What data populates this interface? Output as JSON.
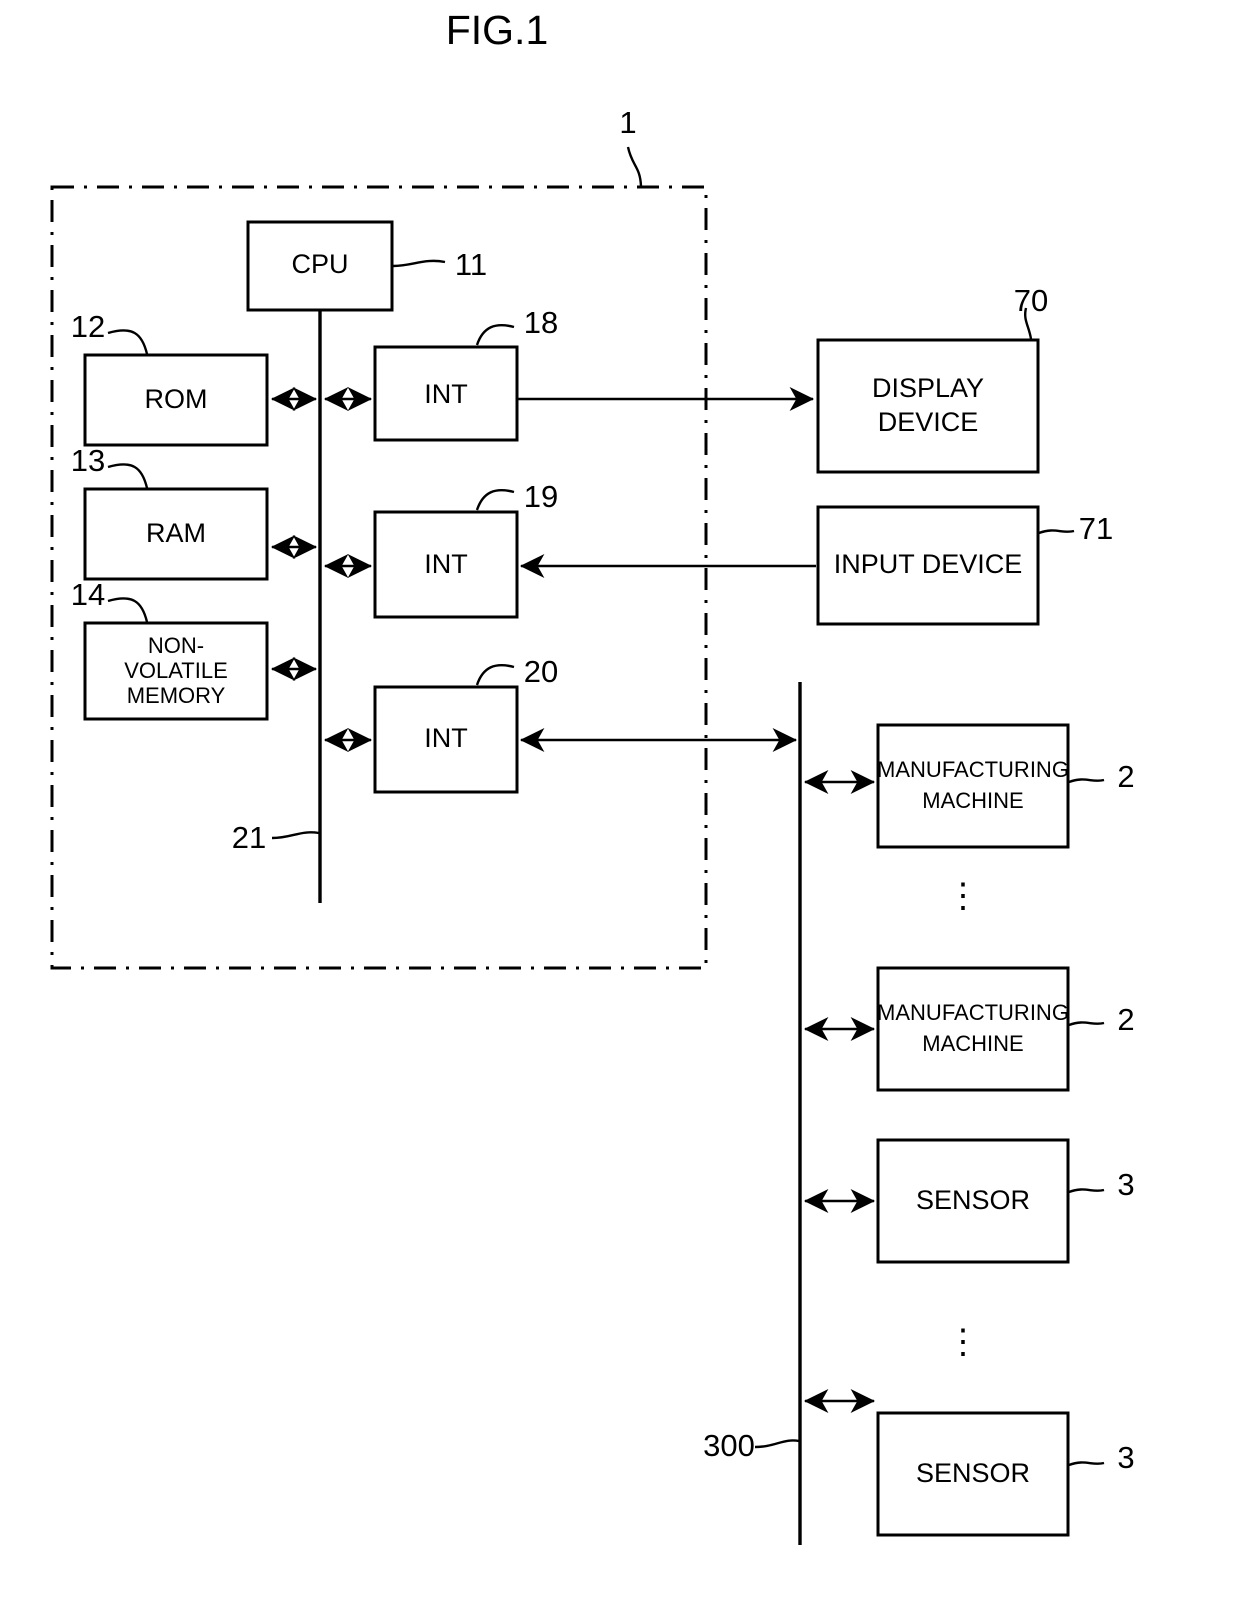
{
  "figure": {
    "title": "FIG.1",
    "system_ref": "1",
    "bus_ref": "21",
    "network_ref": "300"
  },
  "blocks": {
    "cpu": {
      "label": "CPU",
      "ref": "11"
    },
    "rom": {
      "label": "ROM",
      "ref": "12"
    },
    "ram": {
      "label": "RAM",
      "ref": "13"
    },
    "nvm": {
      "label_line1": "NON-",
      "label_line2": "VOLATILE",
      "label_line3": "MEMORY",
      "ref": "14"
    },
    "int1": {
      "label": "INT",
      "ref": "18"
    },
    "int2": {
      "label": "INT",
      "ref": "19"
    },
    "int3": {
      "label": "INT",
      "ref": "20"
    },
    "display_device": {
      "label_line1": "DISPLAY",
      "label_line2": "DEVICE",
      "ref": "70"
    },
    "input_device": {
      "label": "INPUT DEVICE",
      "ref": "71"
    },
    "machine1": {
      "label_line1": "MANUFACTURING",
      "label_line2": "MACHINE",
      "ref": "2"
    },
    "machine2": {
      "label_line1": "MANUFACTURING",
      "label_line2": "MACHINE",
      "ref": "2"
    },
    "sensor1": {
      "label": "SENSOR",
      "ref": "3"
    },
    "sensor2": {
      "label": "SENSOR",
      "ref": "3"
    }
  },
  "ellipsis": {
    "machines": "⋮",
    "sensors": "⋮"
  },
  "colors": {
    "line": "#000000",
    "background": "#ffffff"
  }
}
